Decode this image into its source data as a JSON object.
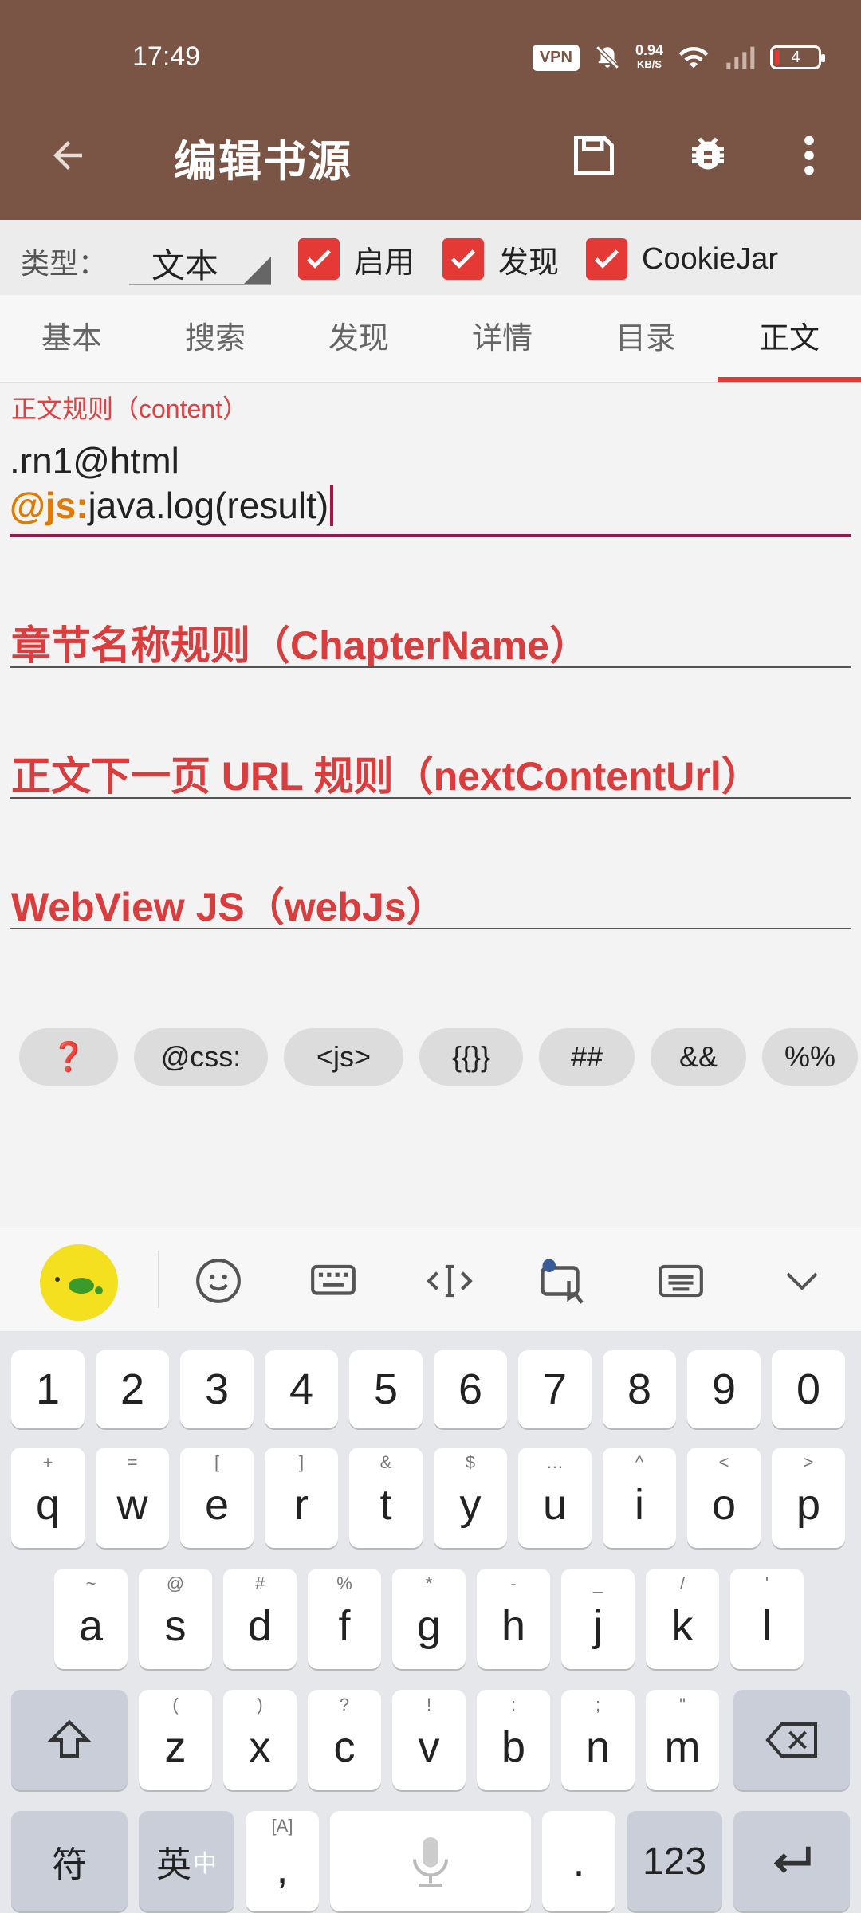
{
  "status": {
    "time": "17:49",
    "vpn": "VPN",
    "speed_value": "0.94",
    "speed_unit": "KB/S",
    "battery": "4"
  },
  "appbar": {
    "title": "编辑书源",
    "back_icon": "arrow-left-icon",
    "save_icon": "save-icon",
    "debug_icon": "bug-icon",
    "more_icon": "more-vert-icon"
  },
  "typerow": {
    "label": "类型：",
    "type_value": "文本",
    "checkboxes": [
      {
        "label": "启用",
        "checked": true
      },
      {
        "label": "发现",
        "checked": true
      },
      {
        "label": "CookieJar",
        "checked": true
      }
    ]
  },
  "tabs": [
    "基本",
    "搜索",
    "发现",
    "详情",
    "目录",
    "正文"
  ],
  "active_tab": "正文",
  "content": {
    "label": "正文规则（content）",
    "line1": ".rn1@html",
    "line2_prefix": "@js:",
    "line2_rest": "java.log(result)"
  },
  "fields": [
    {
      "hint": "章节名称规则（ChapterName）"
    },
    {
      "hint": "正文下一页 URL 规则（nextContentUrl）"
    },
    {
      "hint": "WebView JS（webJs）"
    }
  ],
  "chips": [
    "❓",
    "@css:",
    "<js>",
    "{{}}",
    "##",
    "&&",
    "%%"
  ],
  "keyboard": {
    "numbers": [
      "1",
      "2",
      "3",
      "4",
      "5",
      "6",
      "7",
      "8",
      "9",
      "0"
    ],
    "row1": [
      [
        "+",
        "q"
      ],
      [
        "=",
        "w"
      ],
      [
        "[",
        "e"
      ],
      [
        "]",
        "r"
      ],
      [
        "&",
        "t"
      ],
      [
        "$",
        "y"
      ],
      [
        "…",
        "u"
      ],
      [
        "^",
        "i"
      ],
      [
        "<",
        "o"
      ],
      [
        ">",
        "p"
      ]
    ],
    "row2": [
      [
        "~",
        "a"
      ],
      [
        "@",
        "s"
      ],
      [
        "#",
        "d"
      ],
      [
        "%",
        "f"
      ],
      [
        "*",
        "g"
      ],
      [
        "-",
        "h"
      ],
      [
        "_",
        "j"
      ],
      [
        "/",
        "k"
      ],
      [
        "'",
        "l"
      ]
    ],
    "row3": [
      [
        "(",
        "z"
      ],
      [
        ")",
        "x"
      ],
      [
        "?",
        "c"
      ],
      [
        "!",
        "v"
      ],
      [
        ":",
        "b"
      ],
      [
        ";",
        "n"
      ],
      [
        "\"",
        "m"
      ]
    ],
    "bottom": {
      "fu": "符",
      "ying": "英",
      "zhong": "中",
      "comma": ",",
      "period": ".",
      "num": "123"
    }
  },
  "colors": {
    "appbar": "#7a5545",
    "accent": "#e53935",
    "hint": "#d93d3d"
  }
}
